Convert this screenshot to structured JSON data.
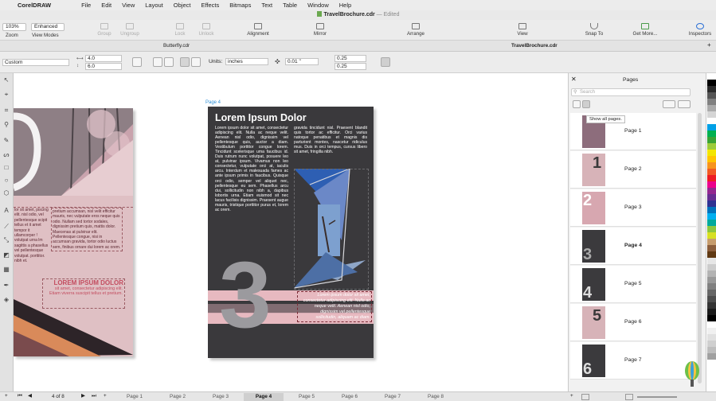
{
  "menubar": {
    "app_name": "CorelDRAW",
    "items": [
      "File",
      "Edit",
      "View",
      "Layout",
      "Object",
      "Effects",
      "Bitmaps",
      "Text",
      "Table",
      "Window",
      "Help"
    ]
  },
  "window": {
    "title": "TravelBrochure.cdr",
    "status": "Edited"
  },
  "toolbar": {
    "zoom_value": "103%",
    "zoom_label": "Zoom",
    "view_mode_value": "Enhanced",
    "view_mode_label": "View Modes",
    "group_label": "Group",
    "ungroup_label": "Ungroup",
    "lock_label": "Lock",
    "unlock_label": "Unlock",
    "alignment_label": "Alignment",
    "mirror_label": "Mirror",
    "arrange_label": "Arrange",
    "view_label": "View",
    "snap_label": "Snap To",
    "get_more_label": "Get More...",
    "inspectors_label": "Inspectors"
  },
  "doc_tabs": {
    "tab1": "Butterfly.cdr",
    "tab2": "TravelBrochure.cdr",
    "add": "+"
  },
  "propbar": {
    "preset": "Custom",
    "width": "4.0",
    "height": "6.0",
    "units_label": "Units:",
    "units_value": "inches",
    "nudge": "0.01 \"",
    "dup_x": "0.25",
    "dup_y": "0.25"
  },
  "canvas": {
    "page4_label": "Page 4",
    "heading": "Lorem Ipsum Dolor",
    "col1": "Lorem ipsum dolor sit amet, consectetur adipiscing elit. Nulla ac neque velit. Aenean nisl odio, dignissim vel pellentesque quis, auctor a diam. Vestibulum porttitor congue lorem. Tincidunt scelerisque uma faucibus id. Duis rutrum nunc volutpat, posuere leo at, pulvinar ipsum. Vivamus non leo consectetur, vulputate orci at, iaculis arcu. Interdum et malesuada fames ac ante ipsum primis in faucibus. Quisque orci odio, semper vel aliquet nec, pellentesque eu sem. Phasellus arcu dui, sollicitudin non nibh a, dapibus lobortis urna. Etiam euismod sit nec lacus facilisis dignissim. Praesent augue mauris, tristique porttitor purus et, lorem ac orem.",
    "col2": "gravida tincidunt nisl. Praesent blandit quis tortor ac efficitur. Orci varius natoque penatibus et magnis dis parturient montes, nascetur ridiculus mus. Duis in orci tempus, cursus libero sit amet, fringilla nibh.",
    "big_number": "3",
    "caption": "Lorem ipsum dolor sit amet, consectetur adipiscing elit. Nulla ac neque velit. Aenean nisl odio, dignissim vel pellentesque sollicitudin, aliquam ac diam.",
    "left_col1": "lor sit amet, piscing elit. nisl odio, vel pellentesque scipit tellus et it amet tempor it ullamcorper ! volutpat urna lm sagittis a phasellus vel pellentesque volutpat. porttitor. nibh et.",
    "left_col2": "pretium accumsan, nisl velit efficitur mauris, nec vulputate eros neque quis odio. Nullam sed tortor sodales, dignissim pretium quis, mattis dolor. Maecenas at pulvinar elit. Pellentesque congue, nisi in accumsan gravida, tortor odio luctus sem, finibus ornare dui lorem ac orem.",
    "left_heading": "LOREM IPSUM DOLOR",
    "left_sub": "sit amet, consectetur adipiscing elit. Etiam viverra suscipit tellus et pretium."
  },
  "pages_panel": {
    "title": "Pages",
    "search_placeholder": "Search",
    "tooltip": "Show all pages.",
    "pages": [
      "Page 1",
      "Page 2",
      "Page 3",
      "Page 4",
      "Page 5",
      "Page 6",
      "Page 7"
    ],
    "selected": "Page 4"
  },
  "bottombar": {
    "page_counter": "4 of 8",
    "tabs": [
      "Page 1",
      "Page 2",
      "Page 3",
      "Page 4",
      "Page 5",
      "Page 6",
      "Page 7",
      "Page 8"
    ],
    "active_tab": "Page 4"
  },
  "palette_colors": [
    "#ffffff",
    "#000000",
    "#2b2b2b",
    "#555555",
    "#808080",
    "#aaaaaa",
    "#d5d5d5",
    "#ffffff",
    "#00a0e6",
    "#00b050",
    "#3aa335",
    "#9ccb3b",
    "#f2e500",
    "#ffc400",
    "#f7941d",
    "#f15a24",
    "#ed1c24",
    "#ec008c",
    "#92278f",
    "#662d91",
    "#2e3192",
    "#0072bc",
    "#00aeef",
    "#00a99d",
    "#8dc63f",
    "#d7df23",
    "#c69c6d",
    "#8b5e3c",
    "#603913",
    "#e6e6e6",
    "#cccccc",
    "#b3b3b3",
    "#999999",
    "#808080",
    "#666666",
    "#4d4d4d",
    "#333333",
    "#1a1a1a",
    "#000000",
    "#ffffff",
    "#f0f0f0",
    "#e0e0e0",
    "#cfcfcf",
    "#bdbdbd",
    "#a0a0a0"
  ]
}
